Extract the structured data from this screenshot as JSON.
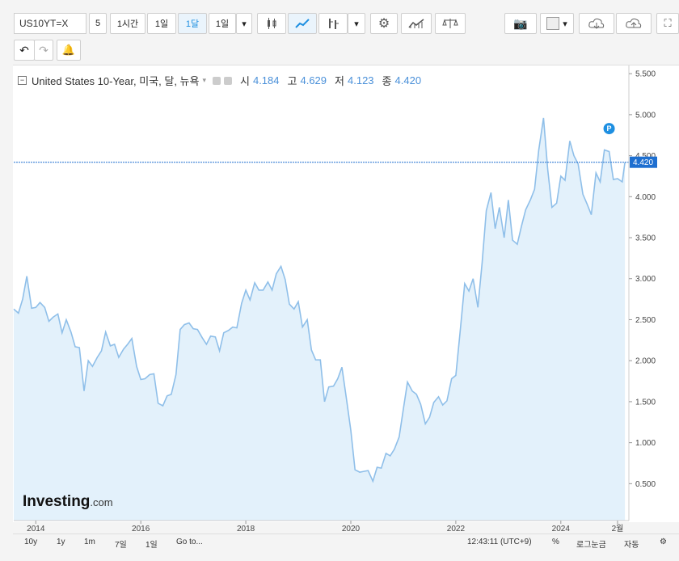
{
  "toolbar": {
    "symbol": "US10YT=X",
    "intervals": [
      "5",
      "1시간",
      "1일",
      "1달",
      "1일"
    ],
    "active_interval": "1달"
  },
  "legend": {
    "title": "United States 10-Year, 미국, 달, 뉴욕",
    "open_label": "시",
    "open": "4.184",
    "high_label": "고",
    "high": "4.629",
    "low_label": "저",
    "low": "4.123",
    "close_label": "종",
    "close": "4.420"
  },
  "last_price": "4.420",
  "marker_label": "P",
  "brand": {
    "name": "Investing",
    "suffix": ".com"
  },
  "bottom": {
    "ranges": [
      "10y",
      "1y",
      "1m",
      "7일",
      "1일",
      "Go to..."
    ],
    "time": "12:43:11 (UTC+9)",
    "percent": "%",
    "log_scale": "로그눈금",
    "auto": "자동"
  },
  "chart_data": {
    "type": "area",
    "color": "#8fbfe9",
    "fill": "#e3f1fb",
    "xlim": [
      2013.58,
      2025.25
    ],
    "ylim": [
      0.05,
      5.6
    ],
    "y_ticks": [
      0.5,
      1.0,
      1.5,
      2.0,
      2.5,
      3.0,
      3.5,
      4.0,
      4.5,
      5.0,
      5.5
    ],
    "y_tick_labels": [
      "0.500",
      "1.000",
      "1.500",
      "2.000",
      "2.500",
      "3.000",
      "3.500",
      "4.000",
      "4.500",
      "5.000",
      "5.500"
    ],
    "x_ticks": [
      2014,
      2016,
      2018,
      2020,
      2022,
      2024,
      2025.08
    ],
    "x_tick_labels": [
      "2014",
      "2016",
      "2018",
      "2020",
      "2022",
      "2024",
      "2월"
    ],
    "points": [
      [
        2013.58,
        2.63
      ],
      [
        2013.67,
        2.58
      ],
      [
        2013.75,
        2.75
      ],
      [
        2013.83,
        3.03
      ],
      [
        2013.92,
        2.64
      ],
      [
        2014.0,
        2.65
      ],
      [
        2014.08,
        2.71
      ],
      [
        2014.17,
        2.65
      ],
      [
        2014.25,
        2.48
      ],
      [
        2014.33,
        2.53
      ],
      [
        2014.42,
        2.57
      ],
      [
        2014.5,
        2.34
      ],
      [
        2014.58,
        2.5
      ],
      [
        2014.67,
        2.35
      ],
      [
        2014.75,
        2.17
      ],
      [
        2014.83,
        2.16
      ],
      [
        2014.92,
        1.63
      ],
      [
        2015.0,
        2.0
      ],
      [
        2015.08,
        1.93
      ],
      [
        2015.17,
        2.04
      ],
      [
        2015.25,
        2.12
      ],
      [
        2015.33,
        2.35
      ],
      [
        2015.42,
        2.18
      ],
      [
        2015.5,
        2.2
      ],
      [
        2015.58,
        2.04
      ],
      [
        2015.67,
        2.14
      ],
      [
        2015.75,
        2.2
      ],
      [
        2015.83,
        2.27
      ],
      [
        2015.92,
        1.93
      ],
      [
        2016.0,
        1.77
      ],
      [
        2016.08,
        1.78
      ],
      [
        2016.17,
        1.83
      ],
      [
        2016.25,
        1.84
      ],
      [
        2016.33,
        1.48
      ],
      [
        2016.42,
        1.45
      ],
      [
        2016.5,
        1.57
      ],
      [
        2016.58,
        1.59
      ],
      [
        2016.67,
        1.83
      ],
      [
        2016.75,
        2.38
      ],
      [
        2016.83,
        2.44
      ],
      [
        2016.92,
        2.46
      ],
      [
        2017.0,
        2.39
      ],
      [
        2017.08,
        2.38
      ],
      [
        2017.17,
        2.28
      ],
      [
        2017.25,
        2.2
      ],
      [
        2017.33,
        2.3
      ],
      [
        2017.42,
        2.29
      ],
      [
        2017.5,
        2.12
      ],
      [
        2017.58,
        2.34
      ],
      [
        2017.67,
        2.37
      ],
      [
        2017.75,
        2.41
      ],
      [
        2017.83,
        2.4
      ],
      [
        2017.92,
        2.7
      ],
      [
        2018.0,
        2.86
      ],
      [
        2018.08,
        2.74
      ],
      [
        2018.17,
        2.95
      ],
      [
        2018.25,
        2.86
      ],
      [
        2018.33,
        2.86
      ],
      [
        2018.42,
        2.96
      ],
      [
        2018.5,
        2.86
      ],
      [
        2018.58,
        3.06
      ],
      [
        2018.67,
        3.15
      ],
      [
        2018.75,
        2.99
      ],
      [
        2018.83,
        2.69
      ],
      [
        2018.92,
        2.63
      ],
      [
        2019.0,
        2.72
      ],
      [
        2019.08,
        2.41
      ],
      [
        2019.17,
        2.5
      ],
      [
        2019.25,
        2.13
      ],
      [
        2019.33,
        2.01
      ],
      [
        2019.42,
        2.01
      ],
      [
        2019.5,
        1.5
      ],
      [
        2019.58,
        1.68
      ],
      [
        2019.67,
        1.69
      ],
      [
        2019.75,
        1.78
      ],
      [
        2019.83,
        1.92
      ],
      [
        2019.92,
        1.52
      ],
      [
        2020.0,
        1.15
      ],
      [
        2020.08,
        0.67
      ],
      [
        2020.17,
        0.64
      ],
      [
        2020.25,
        0.65
      ],
      [
        2020.33,
        0.66
      ],
      [
        2020.42,
        0.53
      ],
      [
        2020.5,
        0.7
      ],
      [
        2020.58,
        0.69
      ],
      [
        2020.67,
        0.87
      ],
      [
        2020.75,
        0.84
      ],
      [
        2020.83,
        0.92
      ],
      [
        2020.92,
        1.07
      ],
      [
        2021.0,
        1.41
      ],
      [
        2021.08,
        1.74
      ],
      [
        2021.17,
        1.63
      ],
      [
        2021.25,
        1.59
      ],
      [
        2021.33,
        1.47
      ],
      [
        2021.42,
        1.23
      ],
      [
        2021.5,
        1.31
      ],
      [
        2021.58,
        1.49
      ],
      [
        2021.67,
        1.56
      ],
      [
        2021.75,
        1.46
      ],
      [
        2021.83,
        1.51
      ],
      [
        2021.92,
        1.78
      ],
      [
        2022.0,
        1.82
      ],
      [
        2022.08,
        2.34
      ],
      [
        2022.17,
        2.94
      ],
      [
        2022.25,
        2.85
      ],
      [
        2022.33,
        3.0
      ],
      [
        2022.42,
        2.65
      ],
      [
        2022.5,
        3.19
      ],
      [
        2022.58,
        3.83
      ],
      [
        2022.67,
        4.05
      ],
      [
        2022.75,
        3.61
      ],
      [
        2022.83,
        3.87
      ],
      [
        2022.92,
        3.5
      ],
      [
        2023.0,
        3.96
      ],
      [
        2023.08,
        3.47
      ],
      [
        2023.17,
        3.42
      ],
      [
        2023.25,
        3.64
      ],
      [
        2023.33,
        3.84
      ],
      [
        2023.42,
        3.96
      ],
      [
        2023.5,
        4.09
      ],
      [
        2023.58,
        4.57
      ],
      [
        2023.67,
        4.96
      ],
      [
        2023.75,
        4.33
      ],
      [
        2023.83,
        3.87
      ],
      [
        2023.92,
        3.92
      ],
      [
        2024.0,
        4.25
      ],
      [
        2024.08,
        4.2
      ],
      [
        2024.17,
        4.68
      ],
      [
        2024.25,
        4.5
      ],
      [
        2024.33,
        4.4
      ],
      [
        2024.42,
        4.03
      ],
      [
        2024.5,
        3.91
      ],
      [
        2024.58,
        3.78
      ],
      [
        2024.67,
        4.29
      ],
      [
        2024.75,
        4.18
      ],
      [
        2024.83,
        4.57
      ],
      [
        2024.92,
        4.55
      ],
      [
        2025.0,
        4.21
      ],
      [
        2025.08,
        4.22
      ],
      [
        2025.17,
        4.18
      ],
      [
        2025.22,
        4.42
      ]
    ]
  }
}
